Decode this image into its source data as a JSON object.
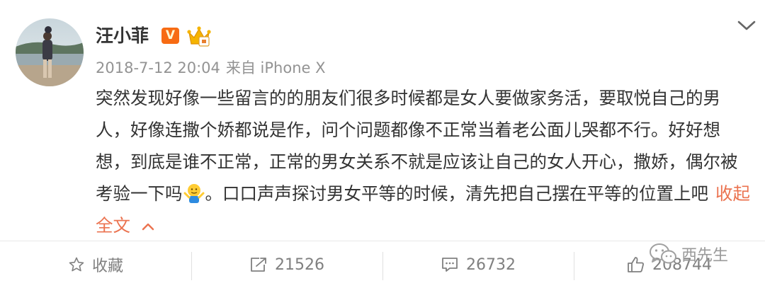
{
  "post": {
    "username": "汪小菲",
    "verified_badge": "V",
    "timestamp": "2018-7-12 20:04",
    "source": "来自 iPhone X",
    "text_before_emoji": "突然发现好像一些留言的的朋友们很多时候都是女人要做家务活，要取悦自己的男人，好像连撒个娇都说是作，问个问题都像不正常当着老公面儿哭都不行。好好想想，到底是谁不正常，正常的男女关系不就是应该让自己的女人开心，撒娇，偶尔被考验一下吗",
    "text_after_emoji": "。口口声声探讨男女平等的时候，清先把自己摆在平等的位置上吧",
    "collapse_label": "收起全文",
    "emoji_icon": "shrug-emoji-icon",
    "menu_icon": "chevron-down-icon"
  },
  "actions": {
    "favorite_label": "收藏",
    "repost_count": "21526",
    "comment_count": "26732",
    "like_count": "208744"
  },
  "watermark": {
    "text": "西先生",
    "icon": "wechat-icon"
  },
  "colors": {
    "accent": "#eb7350",
    "badge_orange": "#f76b13",
    "meta_gray": "#939393",
    "crown_gold": "#f5b400"
  }
}
